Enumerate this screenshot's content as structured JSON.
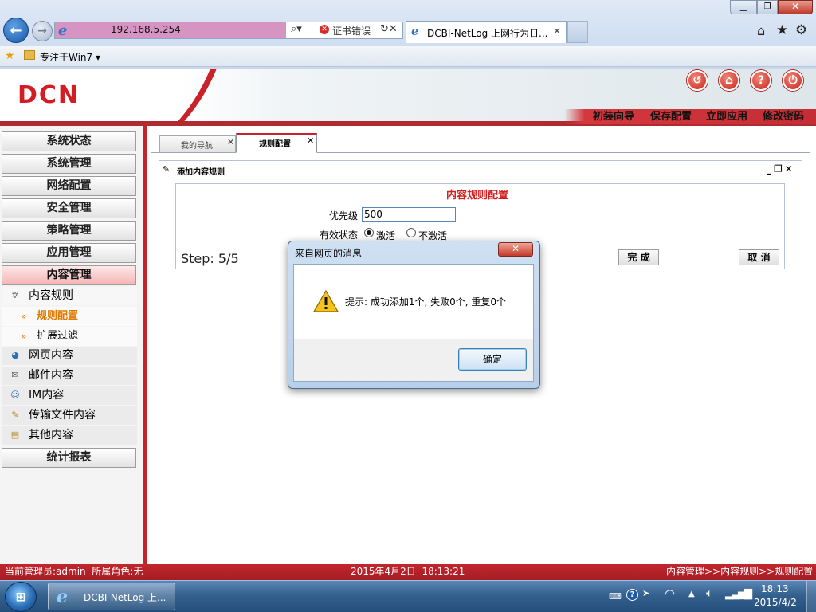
{
  "browser": {
    "address": "192.168.5.254",
    "cert_error": "证书错误",
    "tab_title": "DCBI-NetLog 上网行为日...",
    "favorites_item": "专注于Win7"
  },
  "header": {
    "brand": "DCN",
    "menu": [
      "初装向导",
      "保存配置",
      "立即应用",
      "修改密码"
    ]
  },
  "sidebar": {
    "sections": [
      "系统状态",
      "系统管理",
      "网络配置",
      "安全管理",
      "策略管理",
      "应用管理",
      "内容管理"
    ],
    "content_items": [
      {
        "label": "内容规则",
        "children": [
          "规则配置",
          "扩展过滤"
        ]
      },
      {
        "label": "网页内容"
      },
      {
        "label": "邮件内容"
      },
      {
        "label": "IM内容"
      },
      {
        "label": "传输文件内容"
      },
      {
        "label": "其他内容"
      }
    ],
    "report": "统计报表"
  },
  "tabs": [
    {
      "label": "我的导航",
      "active": false
    },
    {
      "label": "规则配置",
      "active": true
    }
  ],
  "panel": {
    "title": "添加内容规则",
    "form_title": "内容规则配置",
    "priority_label": "优先级",
    "priority_value": "500",
    "status_label": "有效状态",
    "status_options": [
      "激活",
      "不激活"
    ],
    "status_selected": "激活",
    "step": "Step: 5/5",
    "finish": "完 成",
    "cancel": "取 消"
  },
  "dialog": {
    "title": "来自网页的消息",
    "message": "提示: 成功添加1个, 失败0个, 重复0个",
    "ok": "确定"
  },
  "statusbar": {
    "admin": "当前管理员:admin  所属角色:无",
    "datetime": "2015年4月2日  18:13:21",
    "path": "内容管理>>内容规则>>规则配置"
  },
  "taskbar": {
    "task_label": "DCBI-NetLog 上...",
    "clock_time": "18:13",
    "clock_date": "2015/4/2"
  },
  "colors": {
    "brand_red": "#d31d23",
    "status_bar": "#b42228",
    "form_title": "#d61f1f"
  }
}
